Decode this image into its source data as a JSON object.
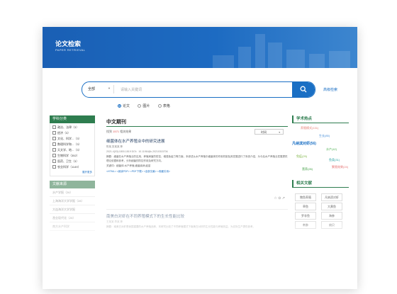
{
  "header": {
    "title": "论文检索",
    "subtitle": "PAPER RETRIEVAL"
  },
  "search": {
    "scope": "全部",
    "placeholder": "请输入关键词",
    "advanced": "高级检索"
  },
  "types": [
    {
      "label": "论文",
      "selected": true
    },
    {
      "label": "图片",
      "selected": false
    },
    {
      "label": "表格",
      "selected": false
    }
  ],
  "subjects": {
    "title": "学科分类",
    "items": [
      "政治、法律（3）",
      "经济（3）",
      "文化、科学...（3）",
      "数理科学和...（3）",
      "天文学、地...（3）",
      "生物科学（352）",
      "医药、卫生（3）",
      "农业科学（1149）"
    ],
    "more": "展开更多"
  },
  "sources": {
    "title": "文献来源",
    "items": [
      "水产学报（26）",
      "上海海洋大学学报（28）",
      "大连海洋大学学报",
      "渔业现代化（28）",
      "南方水产科学"
    ]
  },
  "journal": {
    "title": "中文期刊",
    "result_prefix": "找到",
    "result_count": "1571",
    "result_suffix": "相关结果",
    "sort": "时间"
  },
  "articles": [
    {
      "title": "细菌体在水产养殖业中的研究进展",
      "meta": "陈某,张某某,等",
      "date": "2021.4(03):1800-1819  DOI：10.11964/jfc.20210315706",
      "abstract": "摘要：细菌在水产养殖业的应用，养殖病害的防控、增强免疫力等方面，本综述从水产养殖中细菌体的作用机制及其发展进行了系统介绍，为今后水产养殖业发展提供理论依据和参考，分析细菌的防控作用及研究方向。",
      "keywords": "关键词：细菌体;水产养殖;细菌疾病;疫苗",
      "links": "<HTML>  <阅读PDF>  <PDF下载>  <全部文献>  <收藏引用>",
      "actions": "☆ ⊙ ↗"
    },
    {
      "title": "南美白对虾在不同养殖模式下的生长性能比较",
      "meta": "王某某,李某,等",
      "date": "",
      "abstract": "摘要：南美白对虾是我国重要的水产养殖品种，本研究比较了不同养殖模式下南美白对虾的生长性能与养殖效益，为实际生产提供参考。",
      "keywords": "",
      "links": "",
      "actions": ""
    }
  ],
  "hot": {
    "title": "学术热点",
    "words": [
      "养殖模式(131)",
      "生长(85)",
      "凡纳滨对虾(56)",
      "水产(42)",
      "免疫(29)",
      "鱼类(31)",
      "繁殖效果(24)",
      "营养(26)"
    ],
    "colors": [
      "#e67e73",
      "#4a90d9",
      "#1a6fc4",
      "#4caf50",
      "#7cb342",
      "#29a3a3",
      "#e57373",
      "#43a047"
    ]
  },
  "related": {
    "title": "相关文献",
    "tags": [
      "鲍鱼养殖",
      "凡纳滨对虾",
      "草鱼",
      "大黄鱼",
      "罗非鱼",
      "海参",
      "刺参",
      "扇贝"
    ]
  }
}
